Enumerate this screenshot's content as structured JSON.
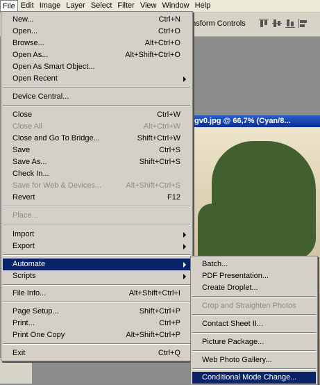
{
  "menubar": {
    "items": [
      "File",
      "Edit",
      "Image",
      "Layer",
      "Select",
      "Filter",
      "View",
      "Window",
      "Help"
    ]
  },
  "options_bar": {
    "label": "ansform Controls"
  },
  "document": {
    "title": "gv0.jpg @ 66,7% (Cyan/8..."
  },
  "file_menu": {
    "items": [
      {
        "label": "New...",
        "shortcut": "Ctrl+N"
      },
      {
        "label": "Open...",
        "shortcut": "Ctrl+O"
      },
      {
        "label": "Browse...",
        "shortcut": "Alt+Ctrl+O"
      },
      {
        "label": "Open As...",
        "shortcut": "Alt+Shift+Ctrl+O"
      },
      {
        "label": "Open As Smart Object...",
        "shortcut": ""
      },
      {
        "label": "Open Recent",
        "shortcut": ""
      },
      {
        "label": "Device Central...",
        "shortcut": ""
      },
      {
        "label": "Close",
        "shortcut": "Ctrl+W"
      },
      {
        "label": "Close All",
        "shortcut": "Alt+Ctrl+W"
      },
      {
        "label": "Close and Go To Bridge...",
        "shortcut": "Shift+Ctrl+W"
      },
      {
        "label": "Save",
        "shortcut": "Ctrl+S"
      },
      {
        "label": "Save As...",
        "shortcut": "Shift+Ctrl+S"
      },
      {
        "label": "Check In...",
        "shortcut": ""
      },
      {
        "label": "Save for Web & Devices...",
        "shortcut": "Alt+Shift+Ctrl+S"
      },
      {
        "label": "Revert",
        "shortcut": "F12"
      },
      {
        "label": "Place...",
        "shortcut": ""
      },
      {
        "label": "Import",
        "shortcut": ""
      },
      {
        "label": "Export",
        "shortcut": ""
      },
      {
        "label": "Automate",
        "shortcut": ""
      },
      {
        "label": "Scripts",
        "shortcut": ""
      },
      {
        "label": "File Info...",
        "shortcut": "Alt+Shift+Ctrl+I"
      },
      {
        "label": "Page Setup...",
        "shortcut": "Shift+Ctrl+P"
      },
      {
        "label": "Print...",
        "shortcut": "Ctrl+P"
      },
      {
        "label": "Print One Copy",
        "shortcut": "Alt+Shift+Ctrl+P"
      },
      {
        "label": "Exit",
        "shortcut": "Ctrl+Q"
      }
    ]
  },
  "automate_submenu": {
    "items": [
      {
        "label": "Batch..."
      },
      {
        "label": "PDF Presentation..."
      },
      {
        "label": "Create Droplet..."
      },
      {
        "label": "Crop and Straighten Photos"
      },
      {
        "label": "Contact Sheet II..."
      },
      {
        "label": "Picture Package..."
      },
      {
        "label": "Web Photo Gallery..."
      },
      {
        "label": "Conditional Mode Change..."
      }
    ]
  },
  "colors": {
    "highlight": "#0a246a",
    "menu_bg": "#d4d0c8",
    "disabled": "#8c8a82"
  }
}
